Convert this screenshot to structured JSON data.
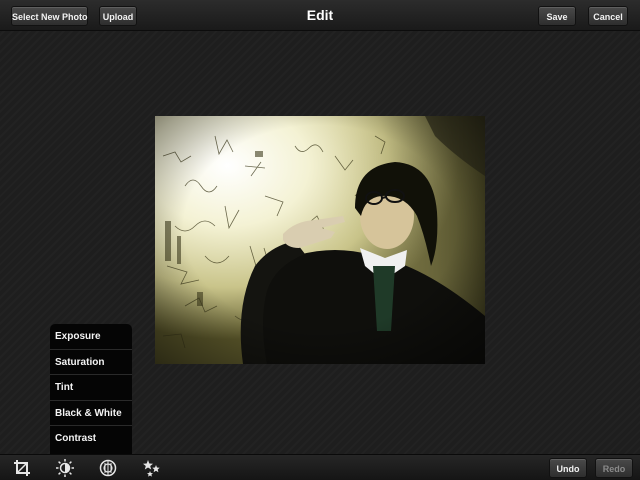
{
  "header": {
    "title": "Edit",
    "select_photo_label": "Select New Photo",
    "upload_label": "Upload",
    "save_label": "Save",
    "cancel_label": "Cancel"
  },
  "menu": {
    "items": [
      {
        "label": "Exposure"
      },
      {
        "label": "Saturation"
      },
      {
        "label": "Tint"
      },
      {
        "label": "Black & White"
      },
      {
        "label": "Contrast"
      }
    ]
  },
  "toolbar": {
    "tools": [
      "crop-icon",
      "brightness-icon",
      "color-filter-icon",
      "effects-sparkle-icon"
    ],
    "undo_label": "Undo",
    "redo_label": "Redo"
  },
  "colors": {
    "background": "#1e1e1e",
    "bar": "#222222",
    "menu_background": "#050505",
    "text": "#ffffff",
    "disabled_text": "#8a8a8a"
  }
}
